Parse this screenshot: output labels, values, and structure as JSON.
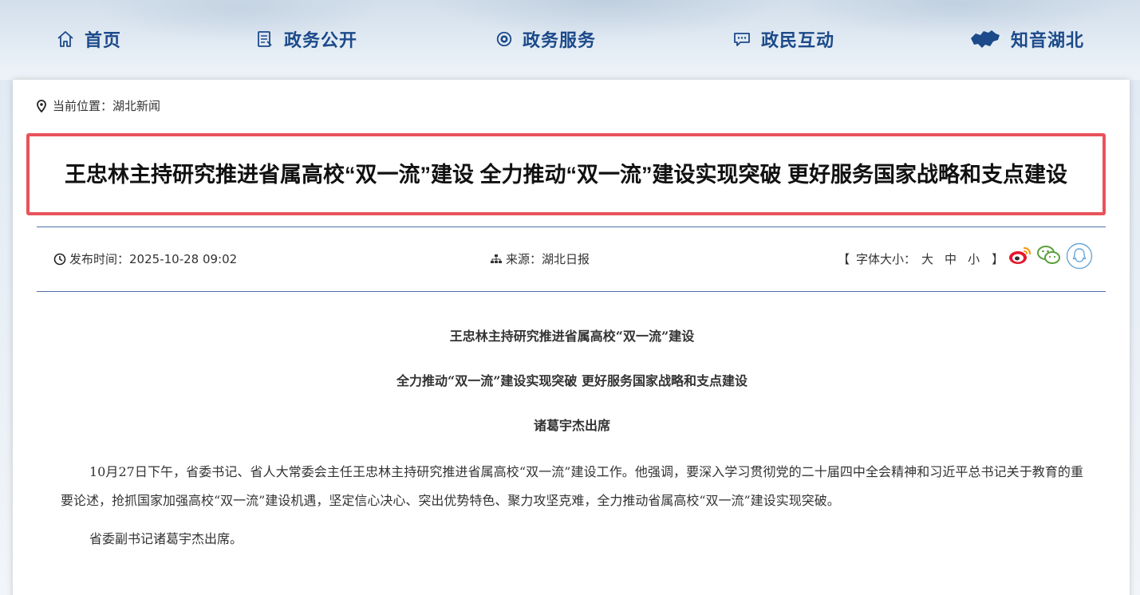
{
  "nav": {
    "items": [
      {
        "label": "首页",
        "icon": "home-icon"
      },
      {
        "label": "政务公开",
        "icon": "document-icon"
      },
      {
        "label": "政务服务",
        "icon": "service-icon"
      },
      {
        "label": "政民互动",
        "icon": "chat-icon"
      },
      {
        "label": "知音湖北",
        "icon": "hubei-map-icon"
      }
    ]
  },
  "breadcrumb": {
    "label": "当前位置：",
    "current": "湖北新闻"
  },
  "article": {
    "title": "王忠林主持研究推进省属高校“双一流”建设 全力推动“双一流”建设实现突破 更好服务国家战略和支点建设",
    "publish_label": "发布时间：",
    "publish_time": "2025-10-28 09:02",
    "source_label": "来源：",
    "source": "湖北日报",
    "font_size_label": "字体大小：",
    "font_sizes": [
      "大",
      "中",
      "小"
    ],
    "bracket_open": "【",
    "bracket_close": "】",
    "subheads": [
      "王忠林主持研究推进省属高校“双一流”建设",
      "全力推动“双一流”建设实现突破 更好服务国家战略和支点建设",
      "诸葛宇杰出席"
    ],
    "paragraphs": [
      "10月27日下午，省委书记、省人大常委会主任王忠林主持研究推进省属高校“双一流”建设工作。他强调，要深入学习贯彻党的二十届四中全会精神和习近平总书记关于教育的重要论述，抢抓国家加强高校“双一流”建设机遇，坚定信心决心、突出优势特色、聚力攻坚克难，全力推动省属高校“双一流”建设实现突破。",
      "省委副书记诸葛宇杰出席。"
    ]
  },
  "share": {
    "icons": [
      "weibo-icon",
      "wechat-icon",
      "qq-icon"
    ]
  },
  "colors": {
    "nav_text": "#1c4a8a",
    "highlight_border": "#e8535a",
    "divider": "#4f6fa8"
  }
}
